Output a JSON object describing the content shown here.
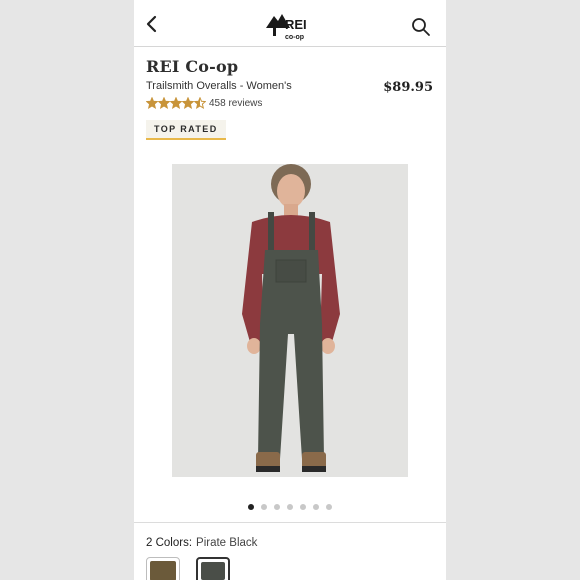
{
  "header": {
    "back_icon": "chevron-left-icon",
    "logo_text": "REI co-op",
    "search_icon": "search-icon"
  },
  "product": {
    "brand": "REI Co-op",
    "name": "Trailsmith Overalls - Women's",
    "price": "$89.95",
    "rating": 4.5,
    "reviews": "458 reviews",
    "badge": "TOP RATED"
  },
  "gallery": {
    "image_count": 7,
    "active_index": 0
  },
  "colors": {
    "label": "2 Colors:",
    "selected_name": "Pirate Black",
    "swatches": [
      {
        "name": "brown-swatch",
        "color": "#6b5a3a",
        "selected": false
      },
      {
        "name": "pirate-black-swatch",
        "color": "#4a4e48",
        "selected": true
      }
    ]
  },
  "theme": {
    "star_color": "#c8943a",
    "badge_accent": "#e8b84a"
  }
}
